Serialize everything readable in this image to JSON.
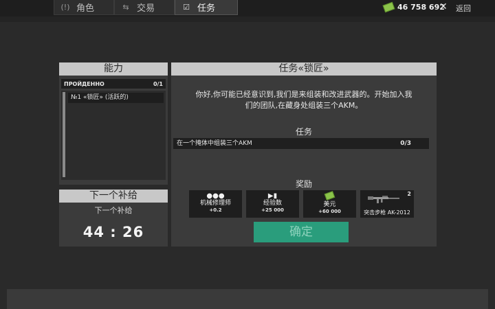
{
  "tabs": [
    {
      "label": "角色",
      "icon": "character-icon"
    },
    {
      "label": "交易",
      "icon": "trade-icon"
    },
    {
      "label": "任务",
      "icon": "task-icon"
    }
  ],
  "header": {
    "money": "46 758 692",
    "close_symbol": "✕",
    "back_label": "返回"
  },
  "abilities": {
    "title": "能力",
    "section_label": "ПРОЙДЕННО",
    "section_count": "0/1",
    "items": [
      "№1 «锁匠» (活跃的)"
    ]
  },
  "supply": {
    "title": "下一个补给",
    "subtitle": "下一个补给",
    "timer": "44 : 26"
  },
  "mission": {
    "title": "任务«锁匠»",
    "description_line1": "你好,你可能已经意识到,我们是来组装和改进武器的。开始加入我",
    "description_line2": "们的团队,在藏身处组装三个AKM。",
    "tasks_label": "任务",
    "task_text": "在一个掩体中组装三个AKM",
    "task_progress": "0/3",
    "rewards_label": "奖励",
    "rewards": [
      {
        "label": "机械修理师",
        "value": "+0.2",
        "icon": "mechanic-icon"
      },
      {
        "label": "经验数",
        "value": "+25 000",
        "icon": "experience-icon"
      },
      {
        "label": "美元",
        "value": "+60 000",
        "icon": "money-icon"
      },
      {
        "label": "突击步枪 AK-2012",
        "count": "2",
        "icon": "rifle-icon"
      }
    ],
    "confirm_label": "确定"
  },
  "colors": {
    "background": "#2a2a2a",
    "panel": "#3b3b3b",
    "title_bar": "#c8c8c8",
    "confirm_button": "#2a9d7c",
    "money_green": "#8bc34a"
  }
}
